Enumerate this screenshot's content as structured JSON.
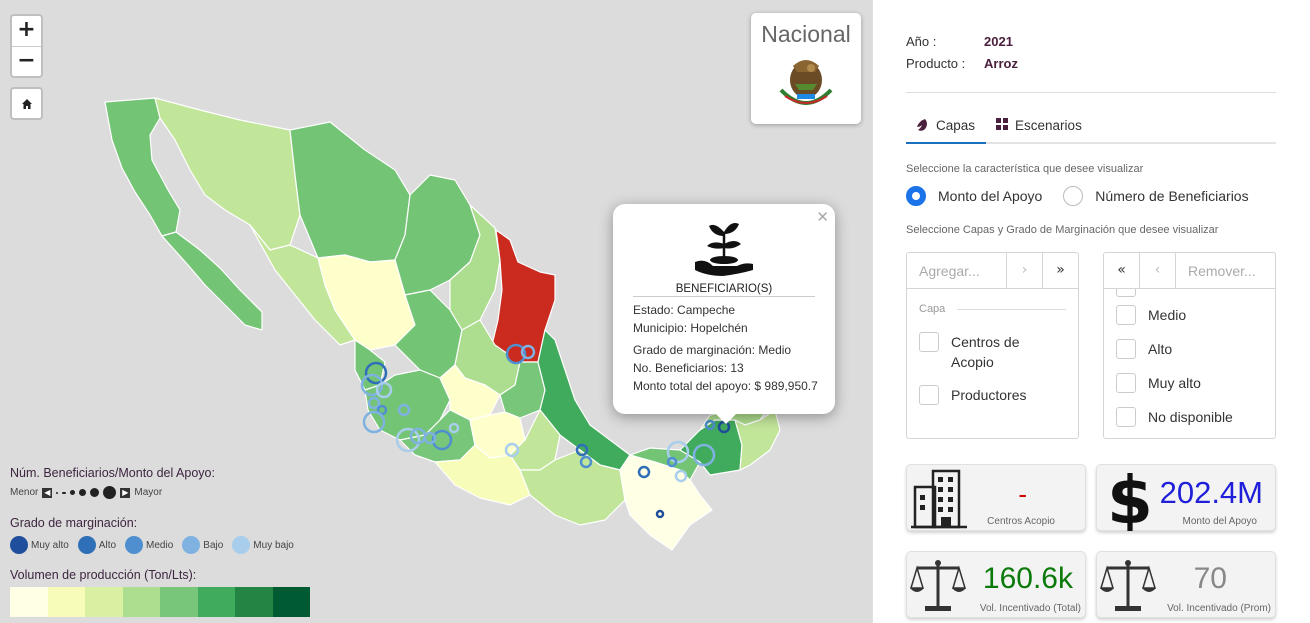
{
  "map": {
    "zoom_in": "+",
    "zoom_out": "−",
    "home_icon": "home-icon",
    "nacional_label": "Nacional",
    "popup": {
      "title": "BENEFICIARIO(S)",
      "estado": "Estado: Campeche",
      "municipio": "Municipio: Hopelchén",
      "grado": "Grado de marginación: Medio",
      "beneficiarios": "No. Beneficiarios: 13",
      "monto": "Monto total del apoyo: $ 989,950.7"
    },
    "legend": {
      "size_title": "Núm. Beneficiarios/Monto del Apoyo:",
      "menor": "Menor",
      "mayor": "Mayor",
      "grade_title": "Grado de marginación:",
      "grades": [
        {
          "label": "Muy alto",
          "color": "#1f4e9c"
        },
        {
          "label": "Alto",
          "color": "#2f6fb8"
        },
        {
          "label": "Medio",
          "color": "#4f8fcf"
        },
        {
          "label": "Bajo",
          "color": "#7fb2e0"
        },
        {
          "label": "Muy bajo",
          "color": "#a9cdec"
        }
      ],
      "volume_title": "Volumen de producción (Ton/Lts):",
      "ramp": [
        "#ffffe5",
        "#f7fcb9",
        "#d9f0a3",
        "#addd8e",
        "#78c679",
        "#41ab5d",
        "#238443",
        "#005a32"
      ]
    }
  },
  "panel": {
    "year_label": "Año :",
    "year_value": "2021",
    "product_label": "Producto :",
    "product_value": "Arroz",
    "tabs": [
      {
        "label": "Capas",
        "icon": "layers-icon"
      },
      {
        "label": "Escenarios",
        "icon": "grid-icon"
      }
    ],
    "hint1": "Seleccione la característica que desee visualizar",
    "radio_monto": "Monto del Apoyo",
    "radio_benef": "Número de Beneficiarios",
    "hint2": "Seleccione Capas y Grado de Marginación que desee visualizar",
    "left_list": {
      "placeholder": "Agregar...",
      "group": "Capa",
      "items": [
        "Centros de Acopio",
        "Productores"
      ]
    },
    "right_list": {
      "placeholder": "Remover...",
      "items": [
        "Medio",
        "Alto",
        "Muy alto",
        "No disponible"
      ]
    },
    "cards": [
      {
        "value": "-",
        "caption": "Centros Acopio",
        "color": "#cc0000",
        "icon": "building-icon"
      },
      {
        "value": "202.4M",
        "caption": "Monto del Apoyo",
        "color": "#1f1fd9",
        "icon": "dollar-icon"
      },
      {
        "value": "160.6k",
        "caption": "Vol. Incentivado (Total)",
        "color": "#0b7a0b",
        "icon": "scale-icon"
      },
      {
        "value": "70",
        "caption": "Vol. Incentivado (Prom)",
        "color": "#888888",
        "icon": "scale-icon"
      }
    ]
  }
}
